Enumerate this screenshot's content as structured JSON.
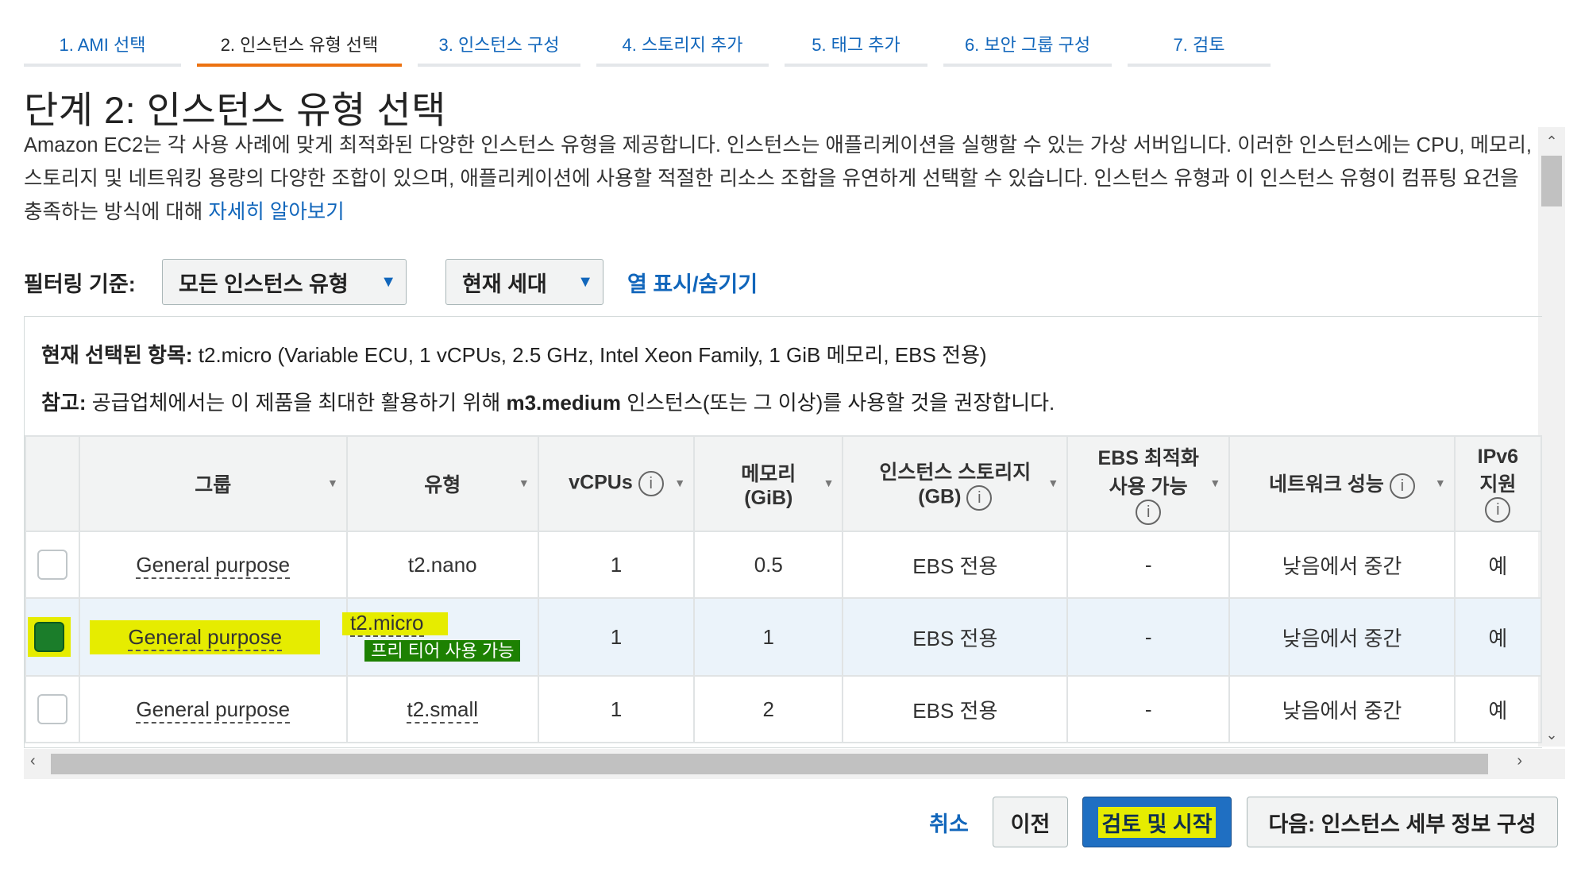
{
  "tabs": [
    {
      "label": "1. AMI 선택"
    },
    {
      "label": "2. 인스턴스 유형 선택"
    },
    {
      "label": "3. 인스턴스 구성"
    },
    {
      "label": "4. 스토리지 추가"
    },
    {
      "label": "5. 태그 추가"
    },
    {
      "label": "6. 보안 그룹 구성"
    },
    {
      "label": "7. 검토"
    }
  ],
  "page": {
    "title": "단계 2: 인스턴스 유형 선택",
    "description": "Amazon EC2는 각 사용 사례에 맞게 최적화된 다양한 인스턴스 유형을 제공합니다. 인스턴스는 애플리케이션을 실행할 수 있는 가상 서버입니다. 이러한 인스턴스에는 CPU, 메모리, 스토리지 및 네트워킹 용량의 다양한 조합이 있으며, 애플리케이션에 사용할 적절한 리소스 조합을 유연하게 선택할 수 있습니다. 인스턴스 유형과 이 인스턴스 유형이 컴퓨팅 요건을 충족하는 방식에 대해 ",
    "learn_more": "자세히 알아보기"
  },
  "filter": {
    "label": "필터링 기준:",
    "instance_family": "모든 인스턴스 유형",
    "generation": "현재 세대",
    "toggle_columns": "열 표시/숨기기"
  },
  "info": {
    "current_label": "현재 선택된 항목:",
    "current_value": " t2.micro (Variable ECU, 1 vCPUs, 2.5 GHz, Intel Xeon Family, 1 GiB 메모리, EBS 전용)",
    "note_label": "참고:",
    "note_pre": " 공급업체에서는 이 제품을 최대한 활용하기 위해 ",
    "note_bold": "m3.medium",
    "note_post": " 인스턴스(또는 그 이상)를 사용할 것을 권장합니다."
  },
  "table": {
    "headers": {
      "group": "그룹",
      "type": "유형",
      "vcpus": "vCPUs",
      "memory_1": "메모리",
      "memory_2": "(GiB)",
      "storage_1": "인스턴스 스토리지",
      "storage_2": "(GB)",
      "ebs_1": "EBS 최적화",
      "ebs_2": "사용 가능",
      "network": "네트워크 성능",
      "ipv6_1": "IPv6",
      "ipv6_2": "지원"
    },
    "rows": [
      {
        "group": "General purpose",
        "type": "t2.nano",
        "vcpus": "1",
        "memory": "0.5",
        "storage": "EBS 전용",
        "ebs": "-",
        "network": "낮음에서 중간",
        "ipv6": "예"
      },
      {
        "group": "General purpose",
        "type": "t2.micro",
        "badge": "프리 티어 사용 가능",
        "vcpus": "1",
        "memory": "1",
        "storage": "EBS 전용",
        "ebs": "-",
        "network": "낮음에서 중간",
        "ipv6": "예"
      },
      {
        "group": "General purpose",
        "type": "t2.small",
        "vcpus": "1",
        "memory": "2",
        "storage": "EBS 전용",
        "ebs": "-",
        "network": "낮음에서 중간",
        "ipv6": "예"
      }
    ]
  },
  "footer": {
    "cancel": "취소",
    "previous": "이전",
    "review_launch": "검토 및 시작",
    "next": "다음: 인스턴스 세부 정보 구성"
  },
  "colors": {
    "link": "#1166bb",
    "active_tab": "#ec7211",
    "primary_button": "#1f6fc2",
    "highlight": "#e6ec00",
    "free_tier_badge": "#1d8102"
  }
}
